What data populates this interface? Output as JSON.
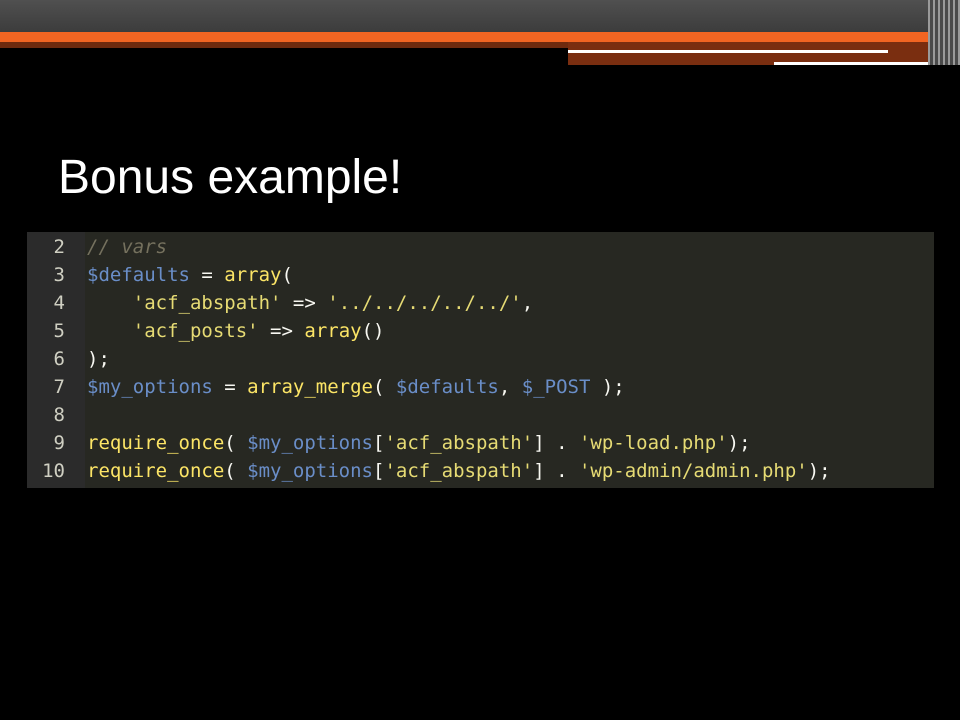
{
  "slide": {
    "title": "Bonus example!"
  },
  "colors": {
    "background": "#000000",
    "accent_orange": "#f26522",
    "code_background": "#272822",
    "comment": "#75715e",
    "variable": "#6a8ec8",
    "string_and_function": "#e6db74"
  },
  "code": {
    "language": "php",
    "line_numbers": [
      "2",
      "3",
      "4",
      "5",
      "6",
      "7",
      "8",
      "9",
      "10"
    ],
    "lines": [
      [
        {
          "t": "// vars",
          "c": "cmt"
        }
      ],
      [
        {
          "t": "$defaults",
          "c": "sv"
        },
        {
          "t": " = ",
          "c": "op"
        },
        {
          "t": "array",
          "c": "fn2"
        },
        {
          "t": "(",
          "c": "pun"
        }
      ],
      [
        {
          "t": "    ",
          "c": "op"
        },
        {
          "t": "'acf_abspath'",
          "c": "st2"
        },
        {
          "t": " => ",
          "c": "op"
        },
        {
          "t": "'../../../../../'",
          "c": "st2"
        },
        {
          "t": ",",
          "c": "pun"
        }
      ],
      [
        {
          "t": "    ",
          "c": "op"
        },
        {
          "t": "'acf_posts'",
          "c": "st2"
        },
        {
          "t": " => ",
          "c": "op"
        },
        {
          "t": "array",
          "c": "fn2"
        },
        {
          "t": "()",
          "c": "pun"
        }
      ],
      [
        {
          "t": ");",
          "c": "pun"
        }
      ],
      [
        {
          "t": "$my_options",
          "c": "sv"
        },
        {
          "t": " = ",
          "c": "op"
        },
        {
          "t": "array_merge",
          "c": "fn2"
        },
        {
          "t": "( ",
          "c": "pun"
        },
        {
          "t": "$defaults",
          "c": "sv"
        },
        {
          "t": ", ",
          "c": "pun"
        },
        {
          "t": "$_POST",
          "c": "sv"
        },
        {
          "t": " );",
          "c": "pun"
        }
      ],
      [
        {
          "t": "",
          "c": "op"
        }
      ],
      [
        {
          "t": "require_once",
          "c": "fn2"
        },
        {
          "t": "( ",
          "c": "pun"
        },
        {
          "t": "$my_options",
          "c": "sv"
        },
        {
          "t": "[",
          "c": "pun"
        },
        {
          "t": "'acf_abspath'",
          "c": "st2"
        },
        {
          "t": "] . ",
          "c": "pun"
        },
        {
          "t": "'wp-load.php'",
          "c": "st2"
        },
        {
          "t": ");",
          "c": "pun"
        }
      ],
      [
        {
          "t": "require_once",
          "c": "fn2"
        },
        {
          "t": "( ",
          "c": "pun"
        },
        {
          "t": "$my_options",
          "c": "sv"
        },
        {
          "t": "[",
          "c": "pun"
        },
        {
          "t": "'acf_abspath'",
          "c": "st2"
        },
        {
          "t": "] . ",
          "c": "pun"
        },
        {
          "t": "'wp-admin/admin.php'",
          "c": "st2"
        },
        {
          "t": ");",
          "c": "pun"
        }
      ]
    ]
  }
}
